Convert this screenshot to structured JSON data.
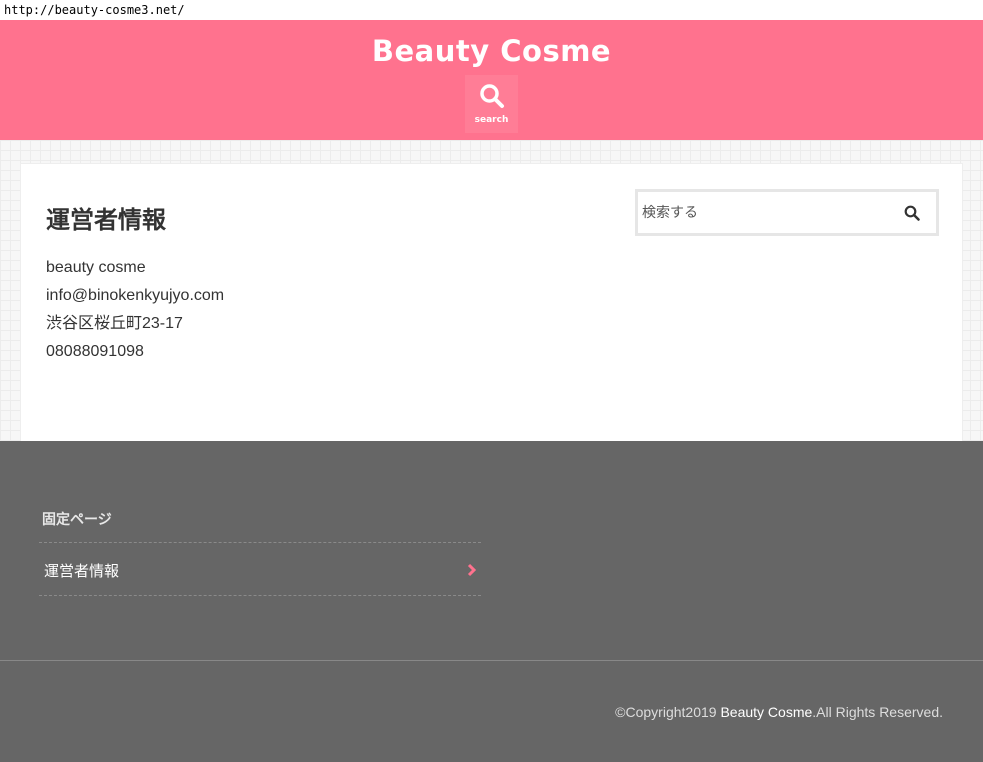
{
  "browser": {
    "url": "http://beauty-cosme3.net/"
  },
  "header": {
    "site_title": "Beauty Cosme",
    "search_label": "search",
    "search_icon": "search-icon"
  },
  "colors": {
    "header_bg": "#ff728e",
    "footer_bg": "#666666",
    "accent": "#ff728e"
  },
  "main": {
    "page_title": "運営者情報",
    "info": [
      "beauty cosme",
      "info@binokenkyujyo.com",
      "渋谷区桜丘町23-17",
      "08088091098"
    ],
    "search": {
      "placeholder": "検索する",
      "value": ""
    }
  },
  "footer": {
    "widget_title": "固定ページ",
    "links": [
      {
        "label": "運営者情報",
        "icon": "chevron-right-icon"
      }
    ],
    "copyright_prefix": "©Copyright2019 ",
    "copyright_brand": "Beauty Cosme",
    "copyright_suffix": ".All Rights Reserved."
  }
}
